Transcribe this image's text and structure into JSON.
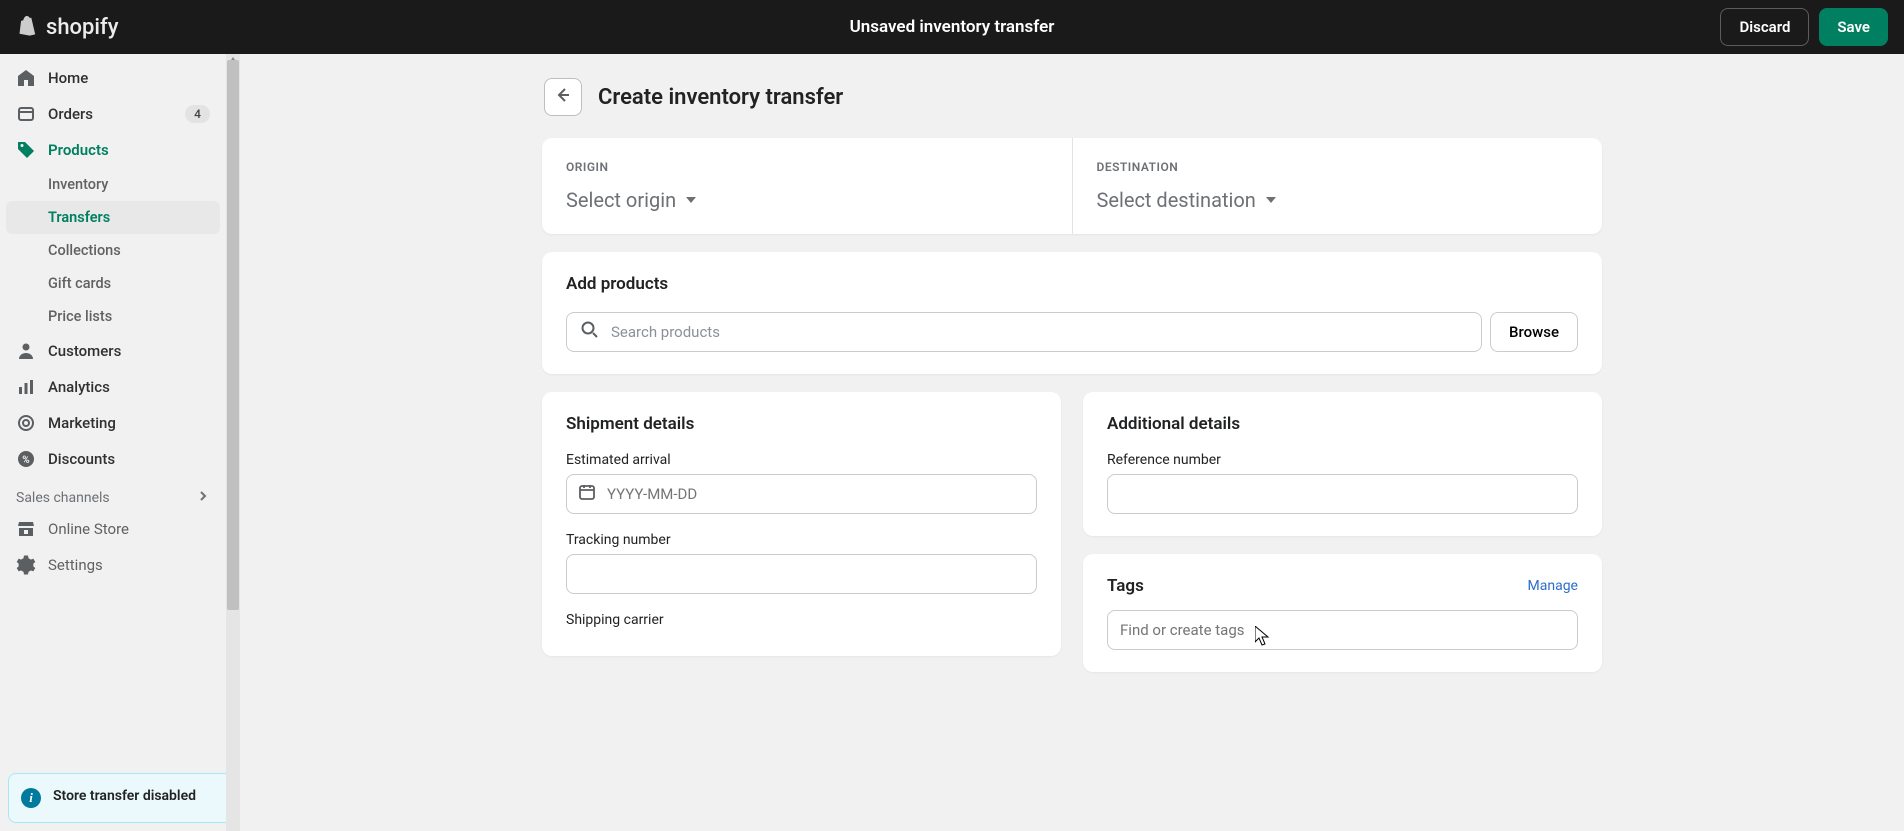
{
  "topbar": {
    "title": "Unsaved inventory transfer",
    "discard": "Discard",
    "save": "Save",
    "brand": "shopify"
  },
  "sidebar": {
    "home": "Home",
    "orders": "Orders",
    "orders_badge": "4",
    "products": "Products",
    "inventory": "Inventory",
    "transfers": "Transfers",
    "collections": "Collections",
    "gift_cards": "Gift cards",
    "price_lists": "Price lists",
    "customers": "Customers",
    "analytics": "Analytics",
    "marketing": "Marketing",
    "discounts": "Discounts",
    "sales_channels": "Sales channels",
    "online_store": "Online Store",
    "settings": "Settings",
    "alert": "Store transfer disabled"
  },
  "page": {
    "title": "Create inventory transfer",
    "origin_label": "ORIGIN",
    "origin_select": "Select origin",
    "destination_label": "DESTINATION",
    "destination_select": "Select destination",
    "add_products": "Add products",
    "search_placeholder": "Search products",
    "browse": "Browse",
    "shipment_details": "Shipment details",
    "estimated_arrival": "Estimated arrival",
    "date_placeholder": "YYYY-MM-DD",
    "tracking_number": "Tracking number",
    "shipping_carrier": "Shipping carrier",
    "additional_details": "Additional details",
    "reference_number": "Reference number",
    "tags": "Tags",
    "manage": "Manage",
    "tags_placeholder": "Find or create tags"
  }
}
